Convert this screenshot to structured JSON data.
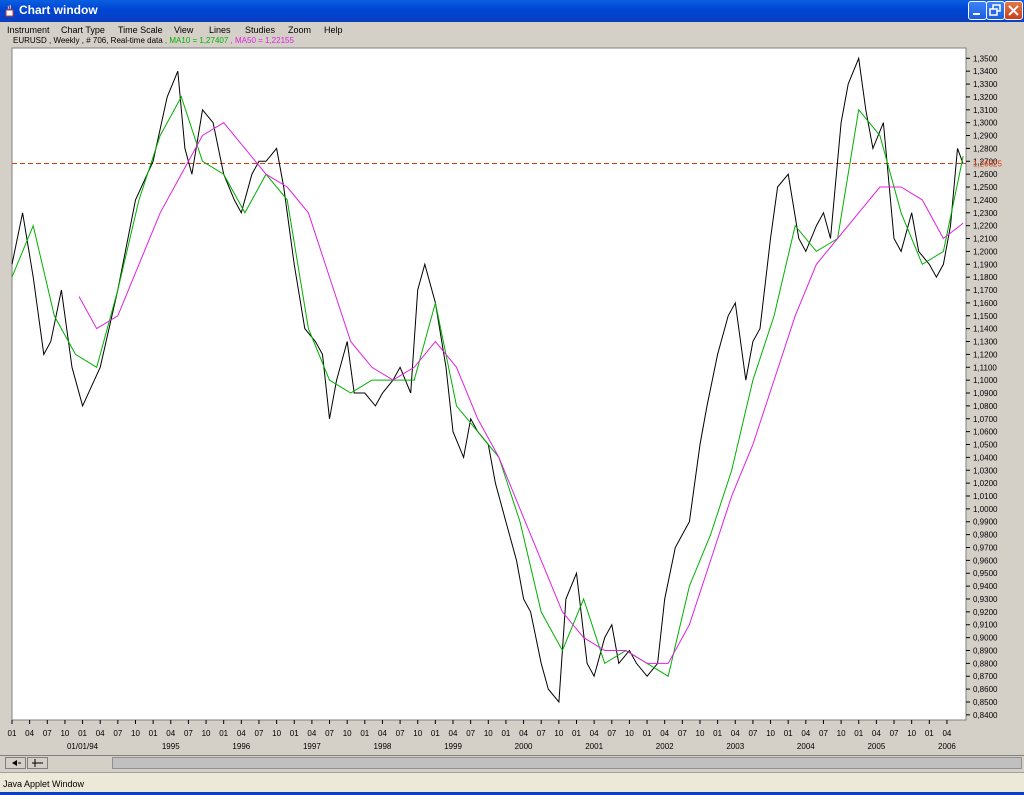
{
  "window": {
    "title": "Chart window",
    "status_text": "Java Applet Window"
  },
  "menu": [
    "Instrument",
    "Chart Type",
    "Time Scale",
    "View",
    "Lines",
    "Studies",
    "Zoom",
    "Help"
  ],
  "legend": {
    "instrument_text": "EURUSD , Weekly , # 706, Real-time data",
    "ma10_text": ", MA10 = 1,27407",
    "ma50_text": ", MA50 = 1,22155",
    "ma10_color": "#00b000",
    "ma50_color": "#e020e0",
    "price_color": "#000000"
  },
  "chart_data": {
    "type": "line",
    "title": "EURUSD , Weekly , # 706, Real-time data",
    "ylim": [
      0.836,
      1.358
    ],
    "xlim": [
      1993.0,
      2006.52
    ],
    "y_ticks": [
      "1,3500",
      "1,3400",
      "1,3300",
      "1,3200",
      "1,3100",
      "1,3000",
      "1,2900",
      "1,2800",
      "1,2700",
      "1,2600",
      "1,2500",
      "1,2400",
      "1,2300",
      "1,2200",
      "1,2100",
      "1,2000",
      "1,1900",
      "1,1800",
      "1,1700",
      "1,1600",
      "1,1500",
      "1,1400",
      "1,1300",
      "1,1200",
      "1,1100",
      "1,1000",
      "1,0900",
      "1,0800",
      "1,0700",
      "1,0600",
      "1,0500",
      "1,0400",
      "1,0300",
      "1,0200",
      "1,0100",
      "1,0000",
      "0,9900",
      "0,9800",
      "0,9700",
      "0,9600",
      "0,9500",
      "0,9400",
      "0,9300",
      "0,9200",
      "0,9100",
      "0,9000",
      "0,8900",
      "0,8800",
      "0,8700",
      "0,8600",
      "0,8500",
      "0,8400"
    ],
    "month_ticks": [
      "01",
      "04",
      "07",
      "10",
      "01",
      "04",
      "07",
      "10",
      "01",
      "04",
      "07",
      "10",
      "01",
      "04",
      "07",
      "10",
      "01",
      "04",
      "07",
      "10",
      "01",
      "04",
      "07",
      "10",
      "01",
      "04",
      "07",
      "10",
      "01",
      "04",
      "07",
      "10",
      "01",
      "04",
      "07",
      "10",
      "01",
      "04",
      "07",
      "10",
      "01",
      "04",
      "07",
      "10",
      "01",
      "04",
      "07",
      "10",
      "01",
      "04",
      "07",
      "10",
      "01",
      "04"
    ],
    "year_labels": [
      "01/01/94",
      "1995",
      "1996",
      "1997",
      "1998",
      "1999",
      "2000",
      "2001",
      "2002",
      "2003",
      "2004",
      "2005",
      "2006"
    ],
    "current_level": {
      "value": 1.26825,
      "label": "1,26825",
      "color": "#e03a10"
    },
    "grid": false,
    "series": [
      {
        "name": "EURUSD",
        "x": [
          1993.0,
          1993.15,
          1993.3,
          1993.45,
          1993.55,
          1993.7,
          1993.85,
          1994.0,
          1994.25,
          1994.5,
          1994.75,
          1995.0,
          1995.2,
          1995.35,
          1995.45,
          1995.55,
          1995.7,
          1995.85,
          1996.0,
          1996.15,
          1996.25,
          1996.4,
          1996.5,
          1996.6,
          1996.75,
          1996.85,
          1997.0,
          1997.15,
          1997.3,
          1997.4,
          1997.5,
          1997.6,
          1997.75,
          1997.85,
          1998.0,
          1998.15,
          1998.25,
          1998.4,
          1998.5,
          1998.65,
          1998.75,
          1998.85,
          1999.0,
          1999.15,
          1999.25,
          1999.4,
          1999.5,
          1999.6,
          1999.75,
          1999.85,
          2000.0,
          2000.15,
          2000.25,
          2000.35,
          2000.5,
          2000.6,
          2000.75,
          2000.85,
          2001.0,
          2001.15,
          2001.25,
          2001.4,
          2001.5,
          2001.6,
          2001.75,
          2001.85,
          2002.0,
          2002.15,
          2002.25,
          2002.4,
          2002.5,
          2002.6,
          2002.75,
          2002.85,
          2003.0,
          2003.15,
          2003.25,
          2003.4,
          2003.5,
          2003.6,
          2003.75,
          2003.85,
          2004.0,
          2004.15,
          2004.25,
          2004.4,
          2004.5,
          2004.6,
          2004.75,
          2004.85,
          2005.0,
          2005.1,
          2005.2,
          2005.35,
          2005.5,
          2005.6,
          2005.75,
          2005.85,
          2006.0,
          2006.1,
          2006.2,
          2006.3,
          2006.4,
          2006.48
        ],
        "values": [
          1.19,
          1.23,
          1.18,
          1.12,
          1.13,
          1.17,
          1.11,
          1.08,
          1.11,
          1.17,
          1.24,
          1.27,
          1.32,
          1.34,
          1.28,
          1.26,
          1.31,
          1.3,
          1.26,
          1.24,
          1.23,
          1.26,
          1.27,
          1.27,
          1.28,
          1.25,
          1.19,
          1.14,
          1.13,
          1.12,
          1.07,
          1.1,
          1.13,
          1.09,
          1.09,
          1.08,
          1.09,
          1.1,
          1.11,
          1.09,
          1.17,
          1.19,
          1.16,
          1.11,
          1.06,
          1.04,
          1.07,
          1.06,
          1.05,
          1.02,
          0.99,
          0.96,
          0.93,
          0.92,
          0.88,
          0.86,
          0.85,
          0.93,
          0.95,
          0.88,
          0.87,
          0.9,
          0.91,
          0.88,
          0.89,
          0.88,
          0.87,
          0.88,
          0.93,
          0.97,
          0.98,
          0.99,
          1.05,
          1.08,
          1.12,
          1.15,
          1.16,
          1.1,
          1.13,
          1.14,
          1.21,
          1.25,
          1.26,
          1.21,
          1.2,
          1.22,
          1.23,
          1.21,
          1.3,
          1.33,
          1.35,
          1.31,
          1.28,
          1.3,
          1.21,
          1.2,
          1.23,
          1.2,
          1.19,
          1.18,
          1.19,
          1.22,
          1.28,
          1.268
        ],
        "color": "#000000"
      },
      {
        "name": "MA10",
        "x": [
          1993.0,
          1993.3,
          1993.6,
          1993.9,
          1994.2,
          1994.5,
          1994.8,
          1995.1,
          1995.4,
          1995.7,
          1996.0,
          1996.3,
          1996.6,
          1996.9,
          1997.2,
          1997.5,
          1997.8,
          1998.1,
          1998.4,
          1998.7,
          1999.0,
          1999.3,
          1999.6,
          1999.9,
          2000.2,
          2000.5,
          2000.8,
          2001.1,
          2001.4,
          2001.7,
          2002.0,
          2002.3,
          2002.6,
          2002.9,
          2003.2,
          2003.5,
          2003.8,
          2004.1,
          2004.4,
          2004.7,
          2005.0,
          2005.3,
          2005.6,
          2005.9,
          2006.2,
          2006.48
        ],
        "values": [
          1.18,
          1.22,
          1.15,
          1.12,
          1.11,
          1.17,
          1.24,
          1.29,
          1.32,
          1.27,
          1.26,
          1.23,
          1.26,
          1.24,
          1.14,
          1.1,
          1.09,
          1.1,
          1.1,
          1.1,
          1.16,
          1.08,
          1.06,
          1.04,
          0.99,
          0.92,
          0.89,
          0.93,
          0.88,
          0.89,
          0.88,
          0.87,
          0.94,
          0.98,
          1.03,
          1.1,
          1.15,
          1.22,
          1.2,
          1.21,
          1.31,
          1.29,
          1.23,
          1.19,
          1.2,
          1.274
        ],
        "color": "#00b000"
      },
      {
        "name": "MA50",
        "x": [
          1993.95,
          1994.2,
          1994.5,
          1994.8,
          1995.1,
          1995.4,
          1995.7,
          1996.0,
          1996.3,
          1996.6,
          1996.9,
          1997.2,
          1997.5,
          1997.8,
          1998.1,
          1998.4,
          1998.7,
          1999.0,
          1999.3,
          1999.6,
          1999.9,
          2000.2,
          2000.5,
          2000.8,
          2001.1,
          2001.4,
          2001.7,
          2002.0,
          2002.3,
          2002.6,
          2002.9,
          2003.2,
          2003.5,
          2003.8,
          2004.1,
          2004.4,
          2004.7,
          2005.0,
          2005.3,
          2005.6,
          2005.9,
          2006.2,
          2006.48
        ],
        "values": [
          1.165,
          1.14,
          1.15,
          1.19,
          1.23,
          1.26,
          1.29,
          1.3,
          1.28,
          1.26,
          1.25,
          1.23,
          1.18,
          1.13,
          1.11,
          1.1,
          1.11,
          1.13,
          1.11,
          1.07,
          1.04,
          1.0,
          0.96,
          0.92,
          0.9,
          0.89,
          0.89,
          0.88,
          0.88,
          0.91,
          0.96,
          1.01,
          1.05,
          1.1,
          1.15,
          1.19,
          1.21,
          1.23,
          1.25,
          1.25,
          1.24,
          1.21,
          1.222
        ],
        "color": "#e020e0"
      }
    ]
  }
}
